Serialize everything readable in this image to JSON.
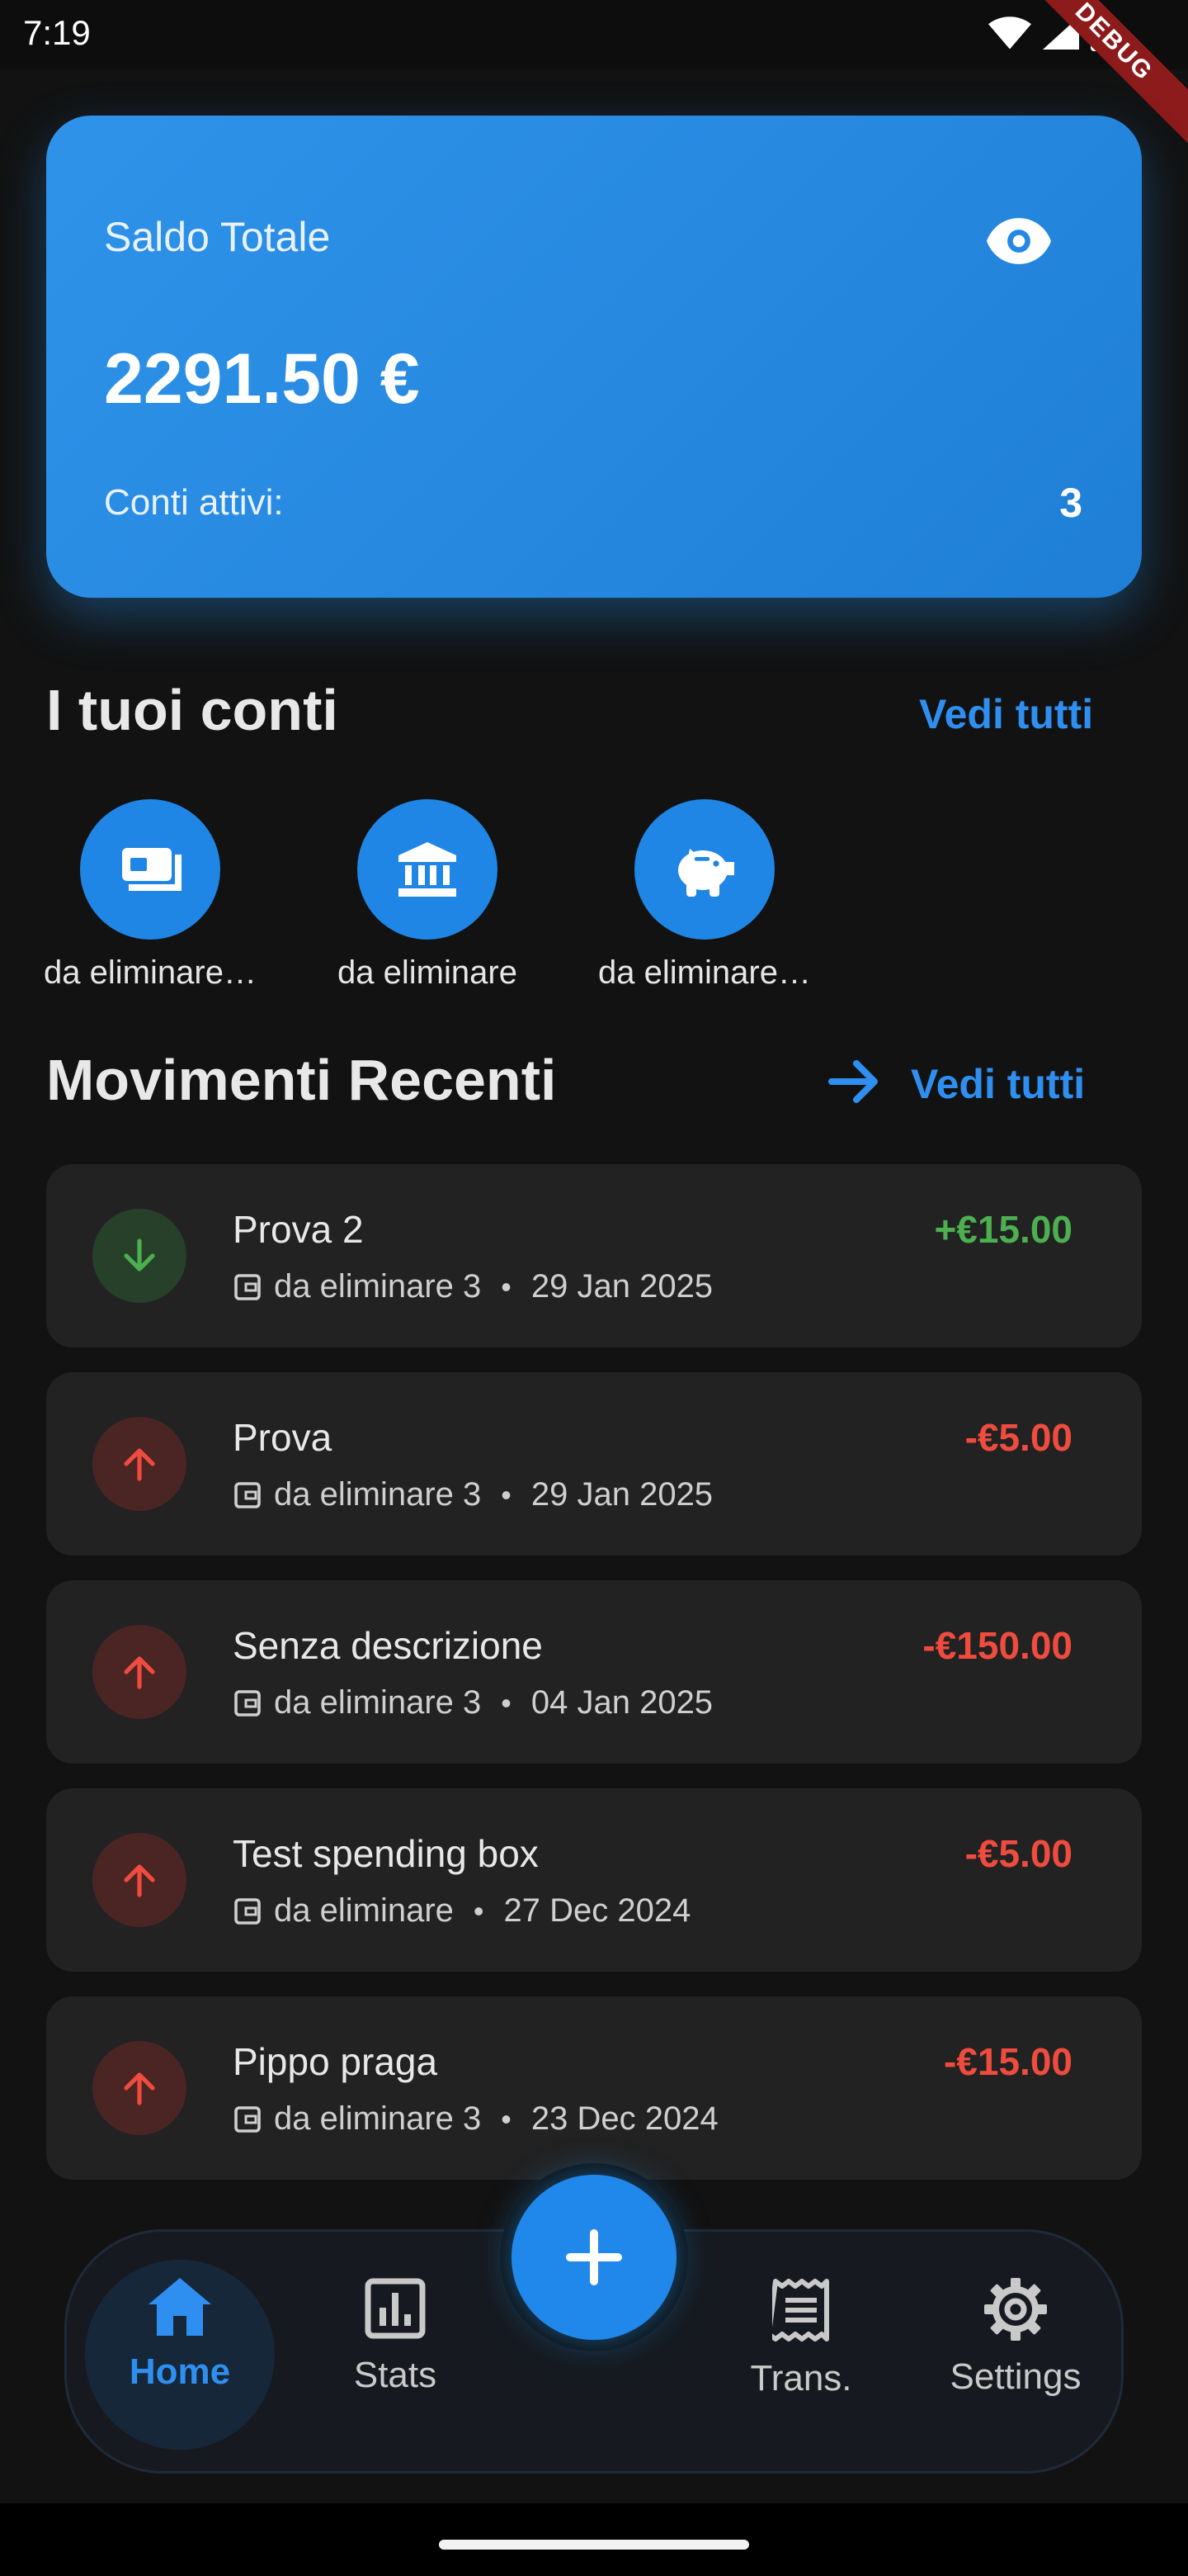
{
  "status_bar": {
    "time": "7:19",
    "debug": "DEBUG"
  },
  "balance_card": {
    "label": "Saldo Totale",
    "amount": "2291.50 €",
    "accounts_label": "Conti attivi:",
    "accounts_count": "3"
  },
  "accounts_section": {
    "title": "I tuoi conti",
    "see_all": "Vedi tutti",
    "items": [
      {
        "name": "da eliminare…",
        "icon": "cash-icon"
      },
      {
        "name": "da eliminare",
        "icon": "bank-icon"
      },
      {
        "name": "da eliminare…",
        "icon": "piggy-bank-icon"
      }
    ]
  },
  "transactions_section": {
    "title": "Movimenti Recenti",
    "see_all": "Vedi tutti",
    "items": [
      {
        "title": "Prova 2",
        "account": "da eliminare 3",
        "date": "29 Jan 2025",
        "amount": "+€15.00",
        "type": "income"
      },
      {
        "title": "Prova",
        "account": "da eliminare 3",
        "date": "29 Jan 2025",
        "amount": "-€5.00",
        "type": "expense"
      },
      {
        "title": "Senza descrizione",
        "account": "da eliminare 3",
        "date": "04 Jan 2025",
        "amount": "-€150.00",
        "type": "expense"
      },
      {
        "title": "Test spending box",
        "account": "da eliminare",
        "date": "27 Dec 2024",
        "amount": "-€5.00",
        "type": "expense"
      },
      {
        "title": "Pippo praga",
        "account": "da eliminare 3",
        "date": "23 Dec 2024",
        "amount": "-€15.00",
        "type": "expense"
      }
    ],
    "separator": "•"
  },
  "bottom_nav": {
    "items": [
      {
        "label": "Home",
        "icon": "home-icon",
        "active": true
      },
      {
        "label": "Stats",
        "icon": "stats-icon",
        "active": false
      },
      {
        "label": "Trans.",
        "icon": "receipt-icon",
        "active": false
      },
      {
        "label": "Settings",
        "icon": "gear-icon",
        "active": false
      }
    ],
    "fab_icon": "plus-icon"
  },
  "colors": {
    "accent": "#2196F3",
    "income": "#4CAF50",
    "expense": "#EF4B3F",
    "background": "#121212",
    "card": "#222222"
  }
}
